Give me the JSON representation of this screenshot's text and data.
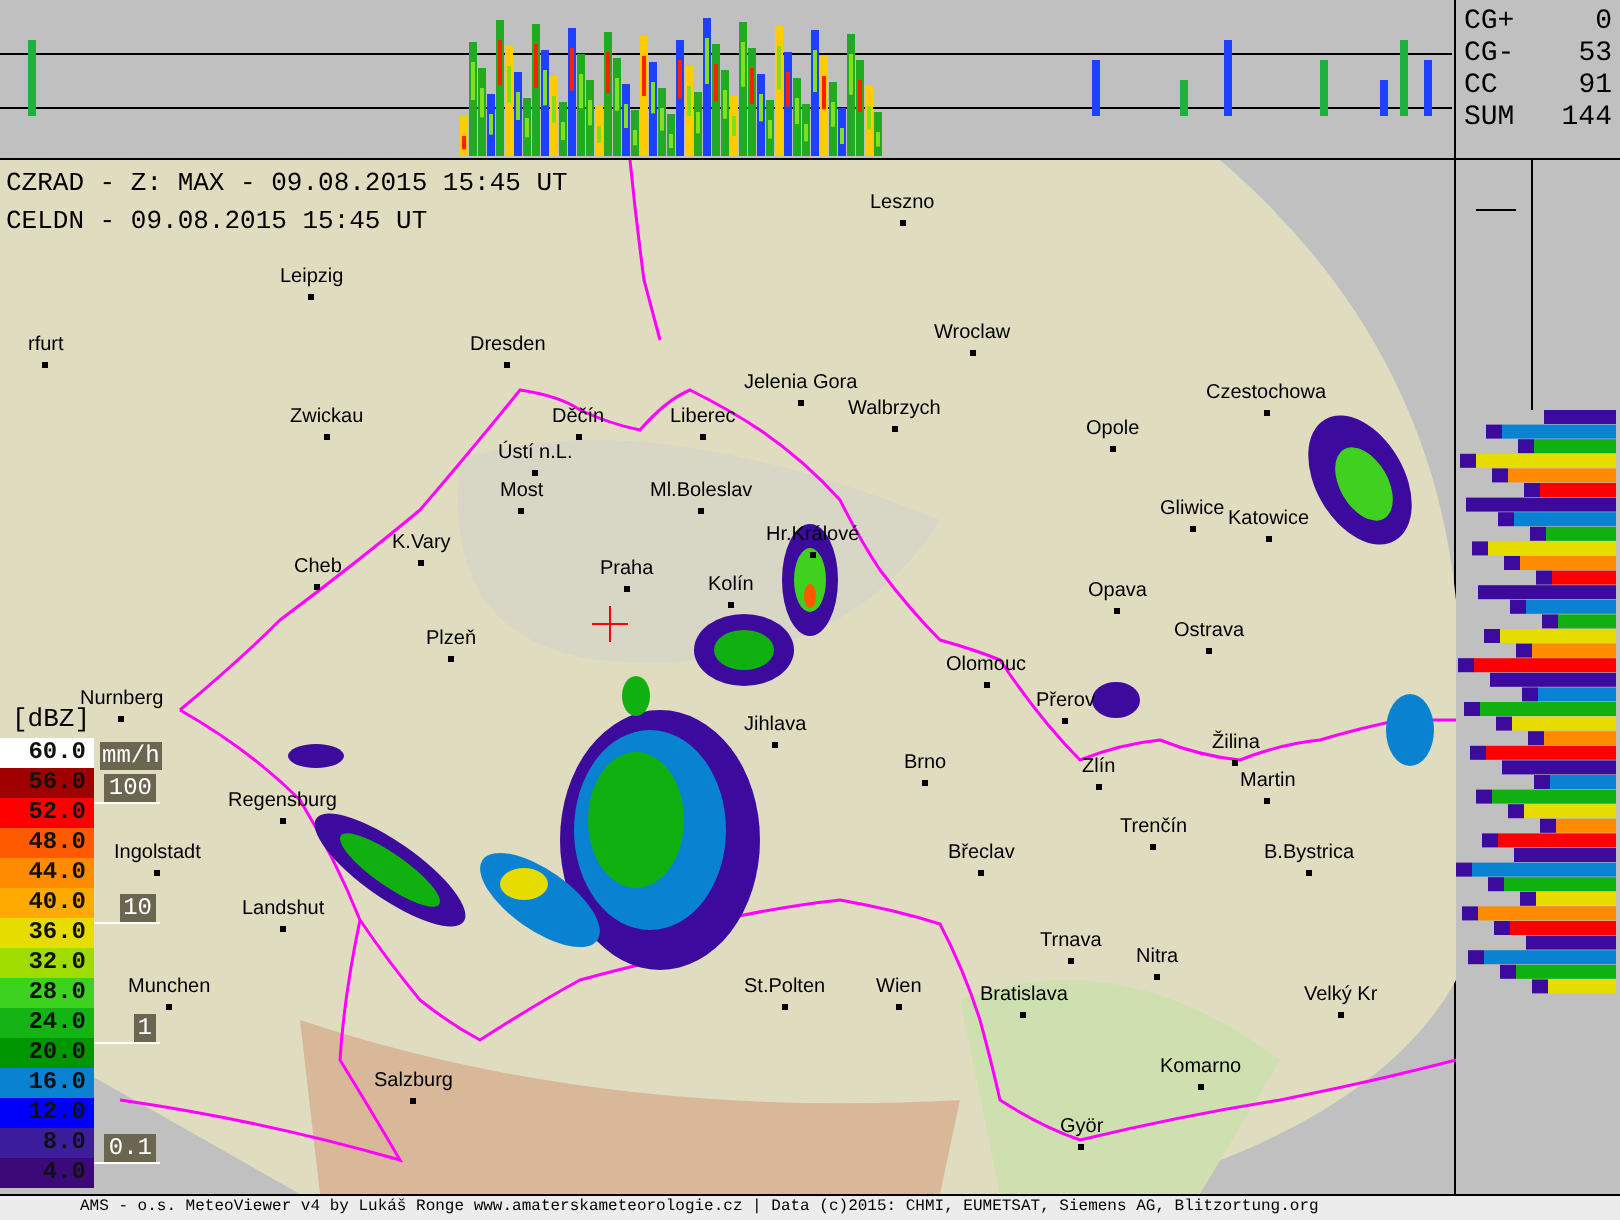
{
  "header": {
    "radar_line": "CZRAD - Z: MAX - 09.08.2015 15:45 UT",
    "lightning_line": "CELDN - 09.08.2015 15:45 UT"
  },
  "lightning_counts": [
    {
      "label": "CG+",
      "value": "0"
    },
    {
      "label": "CG-",
      "value": "53"
    },
    {
      "label": "CC",
      "value": "91"
    },
    {
      "label": "SUM",
      "value": "144"
    }
  ],
  "cities": [
    "Leszno",
    "Leipzig",
    "Wroclaw",
    "rfurt",
    "Dresden",
    "Jelenia Gora",
    "Czestochowa",
    "Zwickau",
    "Děčín",
    "Liberec",
    "Walbrzych",
    "Opole",
    "Ústí n.L.",
    "Most",
    "Ml.Boleslav",
    "Gliwice",
    "Katowice",
    "Hr.Králové",
    "K.Vary",
    "Cheb",
    "Praha",
    "Kolín",
    "Opava",
    "Ostrava",
    "Plzeň",
    "Olomouc",
    "Nurnberg",
    "Přerov",
    "Jihlava",
    "Žilina",
    "Brno",
    "Zlín",
    "Martin",
    "Regensburg",
    "Trenčín",
    "Ingolstadt",
    "Břeclav",
    "B.Bystrica",
    "Landshut",
    "Trnava",
    "Nitra",
    "Munchen",
    "St.Polten",
    "Wien",
    "Bratislava",
    "Velký Kr",
    "Komarno",
    "Salzburg",
    "Györ"
  ],
  "legend": {
    "unit": "[dBZ]",
    "rate_unit": "mm/h",
    "levels": [
      {
        "value": "60.0",
        "color": "#ffffff"
      },
      {
        "value": "56.0",
        "color": "#a00000"
      },
      {
        "value": "52.0",
        "color": "#ff0000"
      },
      {
        "value": "48.0",
        "color": "#ff5a00"
      },
      {
        "value": "44.0",
        "color": "#ff8c00"
      },
      {
        "value": "40.0",
        "color": "#ffaa00"
      },
      {
        "value": "36.0",
        "color": "#e6dc00"
      },
      {
        "value": "32.0",
        "color": "#a0dc00"
      },
      {
        "value": "28.0",
        "color": "#3cd21e"
      },
      {
        "value": "24.0",
        "color": "#14b414"
      },
      {
        "value": "20.0",
        "color": "#009600"
      },
      {
        "value": "16.0",
        "color": "#0a82d2"
      },
      {
        "value": "12.0",
        "color": "#0000fa"
      },
      {
        "value": "8.0",
        "color": "#3c1e9c"
      },
      {
        "value": "4.0",
        "color": "#3c0a78"
      }
    ],
    "rate_marks": [
      "100",
      "10",
      "1",
      "0.1"
    ]
  },
  "footer": "AMS - o.s. MeteoViewer v4 by Lukáš Ronge www.amaterskameteorologie.cz | Data (c)2015: CHMI, EUMETSAT, Siemens AG, Blitzortung.org"
}
